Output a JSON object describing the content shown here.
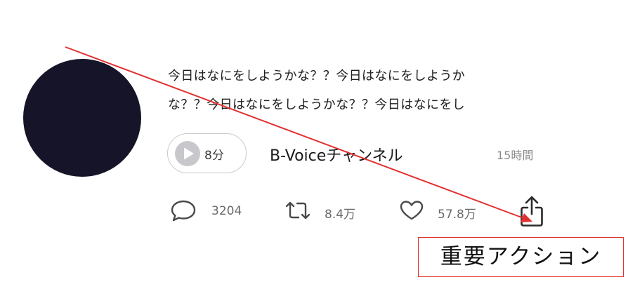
{
  "post": {
    "avatar_color": "#151428",
    "text_line1": "今日はなにをしようかな？？今日はなにをしようか",
    "text_line2": "な？？今日はなにをしようかな？？今日はなにをし",
    "audio_duration": "8分",
    "channel_name": "B-Voiceチャンネル",
    "time_ago": "15時間"
  },
  "actions": {
    "comments": {
      "icon": "comment-icon",
      "count": "3204"
    },
    "reposts": {
      "icon": "repost-icon",
      "count": "8.4万"
    },
    "likes": {
      "icon": "heart-icon",
      "count": "57.8万"
    },
    "share": {
      "icon": "share-icon"
    }
  },
  "annotation": {
    "label": "重要アクション",
    "color": "#e23030"
  }
}
